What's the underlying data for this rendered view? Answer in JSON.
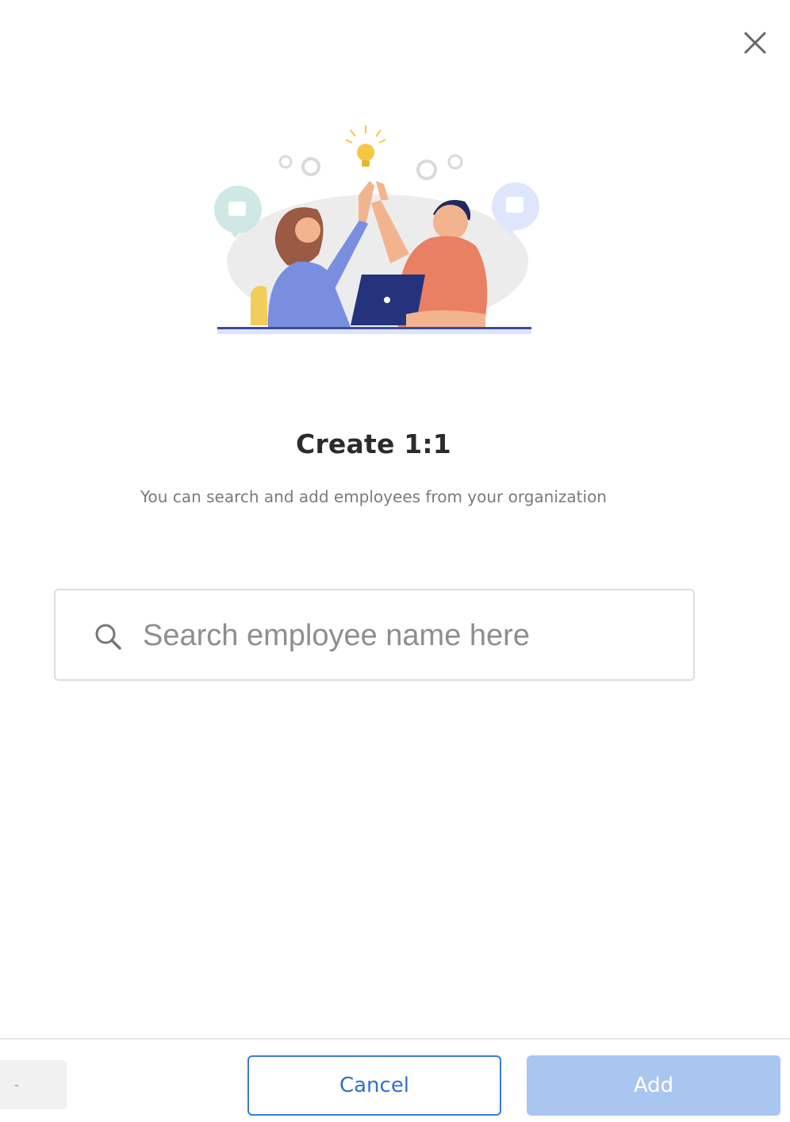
{
  "dialog": {
    "title": "Create 1:1",
    "subtitle": "You can search and add employees from your organization"
  },
  "search": {
    "placeholder": "Search employee name here",
    "value": ""
  },
  "footer": {
    "left_text": "-",
    "cancel_label": "Cancel",
    "add_label": "Add"
  },
  "icons": {
    "close": "close-icon",
    "search": "search-icon"
  },
  "colors": {
    "primary": "#2f6fd0",
    "add_disabled": "#a9c6f1",
    "title": "#2b2b2b",
    "subtitle": "#7a7a7a"
  }
}
